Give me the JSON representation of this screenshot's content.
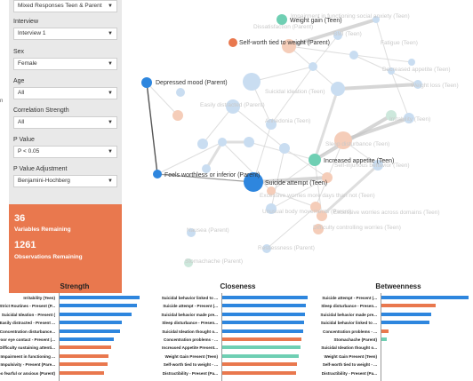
{
  "colors": {
    "blue": "#2e86de",
    "orange": "#e9784e",
    "teal": "#6fcfb3",
    "panel_bg": "#e9e9e9",
    "axis": "#999999"
  },
  "sidebar": {
    "edge_char": "n",
    "dataset_select": {
      "value": "Mixed Responses Teen & Parent"
    },
    "filters": [
      {
        "label": "Interview",
        "value": "Interview 1"
      },
      {
        "label": "Sex",
        "value": "Female"
      },
      {
        "label": "Age",
        "value": "All"
      },
      {
        "label": "Correlation Strength",
        "value": "All"
      },
      {
        "label": "P Value",
        "value": "P < 0.05"
      },
      {
        "label": "P Value Adjustment",
        "value": "Benjamini-Hochberg"
      }
    ],
    "stats": {
      "variables_count": "36",
      "variables_label": "Variables Remaining",
      "observations_count": "1261",
      "observations_label": "Observations Remaining"
    }
  },
  "network": {
    "labeled_nodes": [
      {
        "label": "Depressed mood (Parent)",
        "color": "blue"
      },
      {
        "label": "Self-worth tied to weight (Parent)",
        "color": "orange"
      },
      {
        "label": "Weight gain (Teen)",
        "color": "teal"
      },
      {
        "label": "Feels worthless or inferior (Parent)",
        "color": "blue"
      },
      {
        "label": "Suicide attempt (Teen)",
        "color": "blue"
      },
      {
        "label": "Increased appetite (Teen)",
        "color": "teal"
      }
    ],
    "faded_labels": [
      "Impairment in functioning social anxiety (Teen)",
      "Dissatisfaction (Parent)",
      "BMI (Teen)",
      "Fatigue (Teen)",
      "Decreased appetite (Teen)",
      "Weight loss (Teen)",
      "Easily distracted (Parent)",
      "Suicidal ideation (Teen)",
      "Irritability (Teen)",
      "Anhedonia (Teen)",
      "Sleep disturbance (Teen)",
      "Self-injurious behavior (Teen)",
      "Excessive worries more days than not (Teen)",
      "Excessive worries across domains (Teen)",
      "Difficulty controlling worries (Teen)",
      "Nausea (Parent)",
      "Restlessness (Parent)",
      "Stomachache (Parent)",
      "Unusual body movements (Parent)"
    ]
  },
  "charts": [
    {
      "title": "Strength",
      "items": [
        {
          "label": "Irritability (Teen)",
          "value": 1.0,
          "color": "blue"
        },
        {
          "label": "Strict Routines - Present (P...",
          "value": 0.97,
          "color": "blue"
        },
        {
          "label": "Suicidal Ideation - Present (",
          "value": 0.9,
          "color": "blue"
        },
        {
          "label": "Easily distracted - Present ...",
          "value": 0.78,
          "color": "blue"
        },
        {
          "label": "Concentration disturbance...",
          "value": 0.75,
          "color": "blue"
        },
        {
          "label": "Poor eye contact - Present (...",
          "value": 0.68,
          "color": "blue"
        },
        {
          "label": "Difficulty sustaining attenti...",
          "value": 0.64,
          "color": "orange"
        },
        {
          "label": "Impairment in functioning ...",
          "value": 0.61,
          "color": "orange"
        },
        {
          "label": "Impulsivity - Present (Pare...",
          "value": 0.6,
          "color": "orange"
        },
        {
          "label": "Too fearful or anxious (Parent)",
          "value": 0.55,
          "color": "orange"
        }
      ]
    },
    {
      "title": "Closeness",
      "items": [
        {
          "label": "Suicidal behavior linked to ...",
          "value": 1.0,
          "color": "blue"
        },
        {
          "label": "Suicide attempt - Present (...",
          "value": 0.98,
          "color": "blue"
        },
        {
          "label": "Suicidal behavior made pre...",
          "value": 0.97,
          "color": "blue"
        },
        {
          "label": "Sleep disturbance - Presen...",
          "value": 0.96,
          "color": "blue"
        },
        {
          "label": "Suicidal Ideation thought o...",
          "value": 0.95,
          "color": "blue"
        },
        {
          "label": "Concentration problems - ...",
          "value": 0.93,
          "color": "orange"
        },
        {
          "label": "Increased Appetite Present...",
          "value": 0.92,
          "color": "teal"
        },
        {
          "label": "Weight Gain Present (Teen)",
          "value": 0.9,
          "color": "teal"
        },
        {
          "label": "Self-worth tied to weight - ...",
          "value": 0.88,
          "color": "orange"
        },
        {
          "label": "Distractibility - Present (Pa...",
          "value": 0.86,
          "color": "orange"
        }
      ]
    },
    {
      "title": "Betweenness",
      "items": [
        {
          "label": "Suicide attempt - Present (...",
          "value": 1.0,
          "color": "blue"
        },
        {
          "label": "Sleep disturbance - Presen...",
          "value": 0.62,
          "color": "orange"
        },
        {
          "label": "Suicidal behavior made pre...",
          "value": 0.57,
          "color": "blue"
        },
        {
          "label": "Suicidal behavior linked to ...",
          "value": 0.55,
          "color": "blue"
        },
        {
          "label": "Concentration problems - ...",
          "value": 0.08,
          "color": "orange"
        },
        {
          "label": "Stomachache (Parent)",
          "value": 0.06,
          "color": "teal"
        },
        {
          "label": "Suicidal Ideation thought o...",
          "value": 0.0,
          "color": "blue"
        },
        {
          "label": "Weight Gain Present (Teen)",
          "value": 0.0,
          "color": "teal"
        },
        {
          "label": "Self-worth tied to weight - ...",
          "value": 0.0,
          "color": "orange"
        },
        {
          "label": "Distractibility - Present (Pa...",
          "value": 0.0,
          "color": "orange"
        }
      ]
    }
  ]
}
